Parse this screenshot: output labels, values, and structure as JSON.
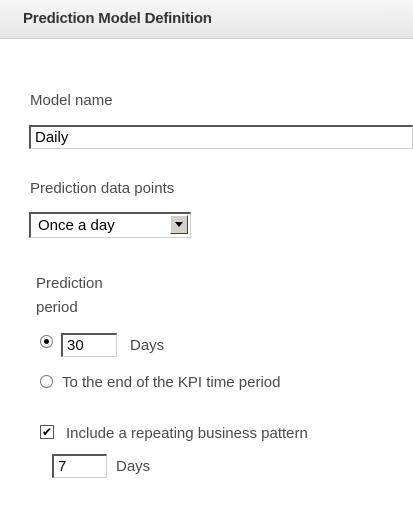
{
  "header": {
    "title": "Prediction Model Definition"
  },
  "model_name": {
    "label": "Model name",
    "value": "Daily"
  },
  "data_points": {
    "label": "Prediction data points",
    "selected": "Once a day"
  },
  "prediction_period": {
    "label_line1": "Prediction",
    "label_line2": "period",
    "days_option": {
      "checked": true,
      "value": "30",
      "unit": "Days"
    },
    "end_option": {
      "checked": false,
      "label": "To the end of the KPI time period"
    }
  },
  "repeating_pattern": {
    "checked": true,
    "check_mark": "✔",
    "label": "Include a repeating business pattern",
    "value": "7",
    "unit": "Days"
  },
  "icons": {
    "dropdown": "chevron-down-icon"
  }
}
